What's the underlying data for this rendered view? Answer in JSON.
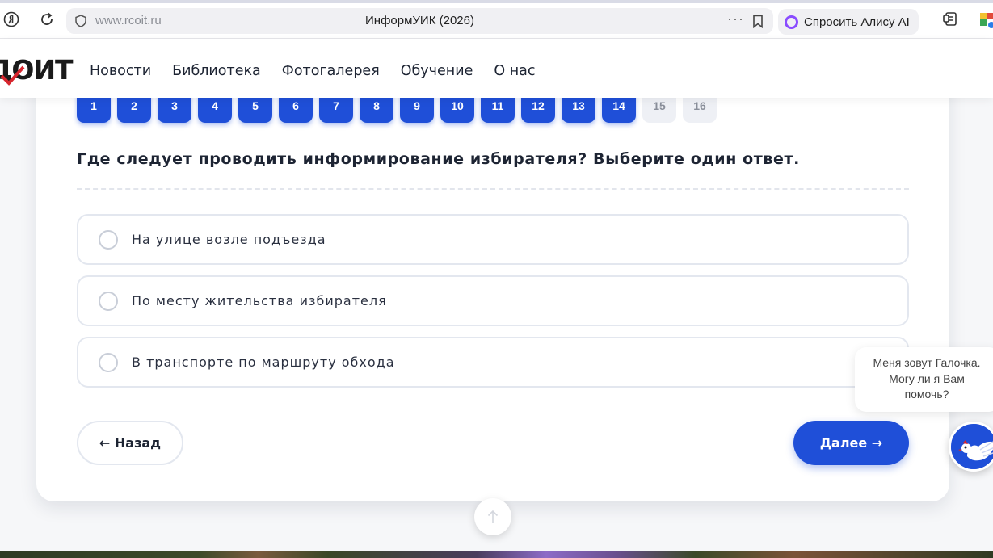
{
  "browser": {
    "url": "www.rcoit.ru",
    "tab_title": "ИнформУИК (2026)",
    "more": "···",
    "alice_label": "Спросить Алису AI"
  },
  "header": {
    "logo_text": "ДОИТ",
    "nav": [
      "Новости",
      "Библиотека",
      "Фотогалерея",
      "Обучение",
      "О нас"
    ]
  },
  "quiz": {
    "question_numbers": [
      {
        "label": "1",
        "state": "done"
      },
      {
        "label": "2",
        "state": "done"
      },
      {
        "label": "3",
        "state": "done"
      },
      {
        "label": "4",
        "state": "done"
      },
      {
        "label": "5",
        "state": "done"
      },
      {
        "label": "6",
        "state": "done"
      },
      {
        "label": "7",
        "state": "done"
      },
      {
        "label": "8",
        "state": "done"
      },
      {
        "label": "9",
        "state": "done"
      },
      {
        "label": "10",
        "state": "done"
      },
      {
        "label": "11",
        "state": "done"
      },
      {
        "label": "12",
        "state": "done"
      },
      {
        "label": "13",
        "state": "done"
      },
      {
        "label": "14",
        "state": "done"
      },
      {
        "label": "15",
        "state": "todo"
      },
      {
        "label": "16",
        "state": "todo"
      }
    ],
    "question": "Где следует проводить информирование избирателя? Выберите один ответ.",
    "options": [
      "На улице возле подъезда",
      "По месту жительства избирателя",
      "В транспорте по маршруту обхода"
    ],
    "back_label": "← Назад",
    "next_label": "Далее →"
  },
  "assistant": {
    "lines": [
      "Меня зовут Галочка.",
      "Могу ли я Вам",
      "помочь?"
    ]
  },
  "colors": {
    "accent": "#1f4fd8",
    "pending": "#eef0f5",
    "logo_check": "#d7262e"
  },
  "scroll_top_icon": "arrow-up-icon"
}
